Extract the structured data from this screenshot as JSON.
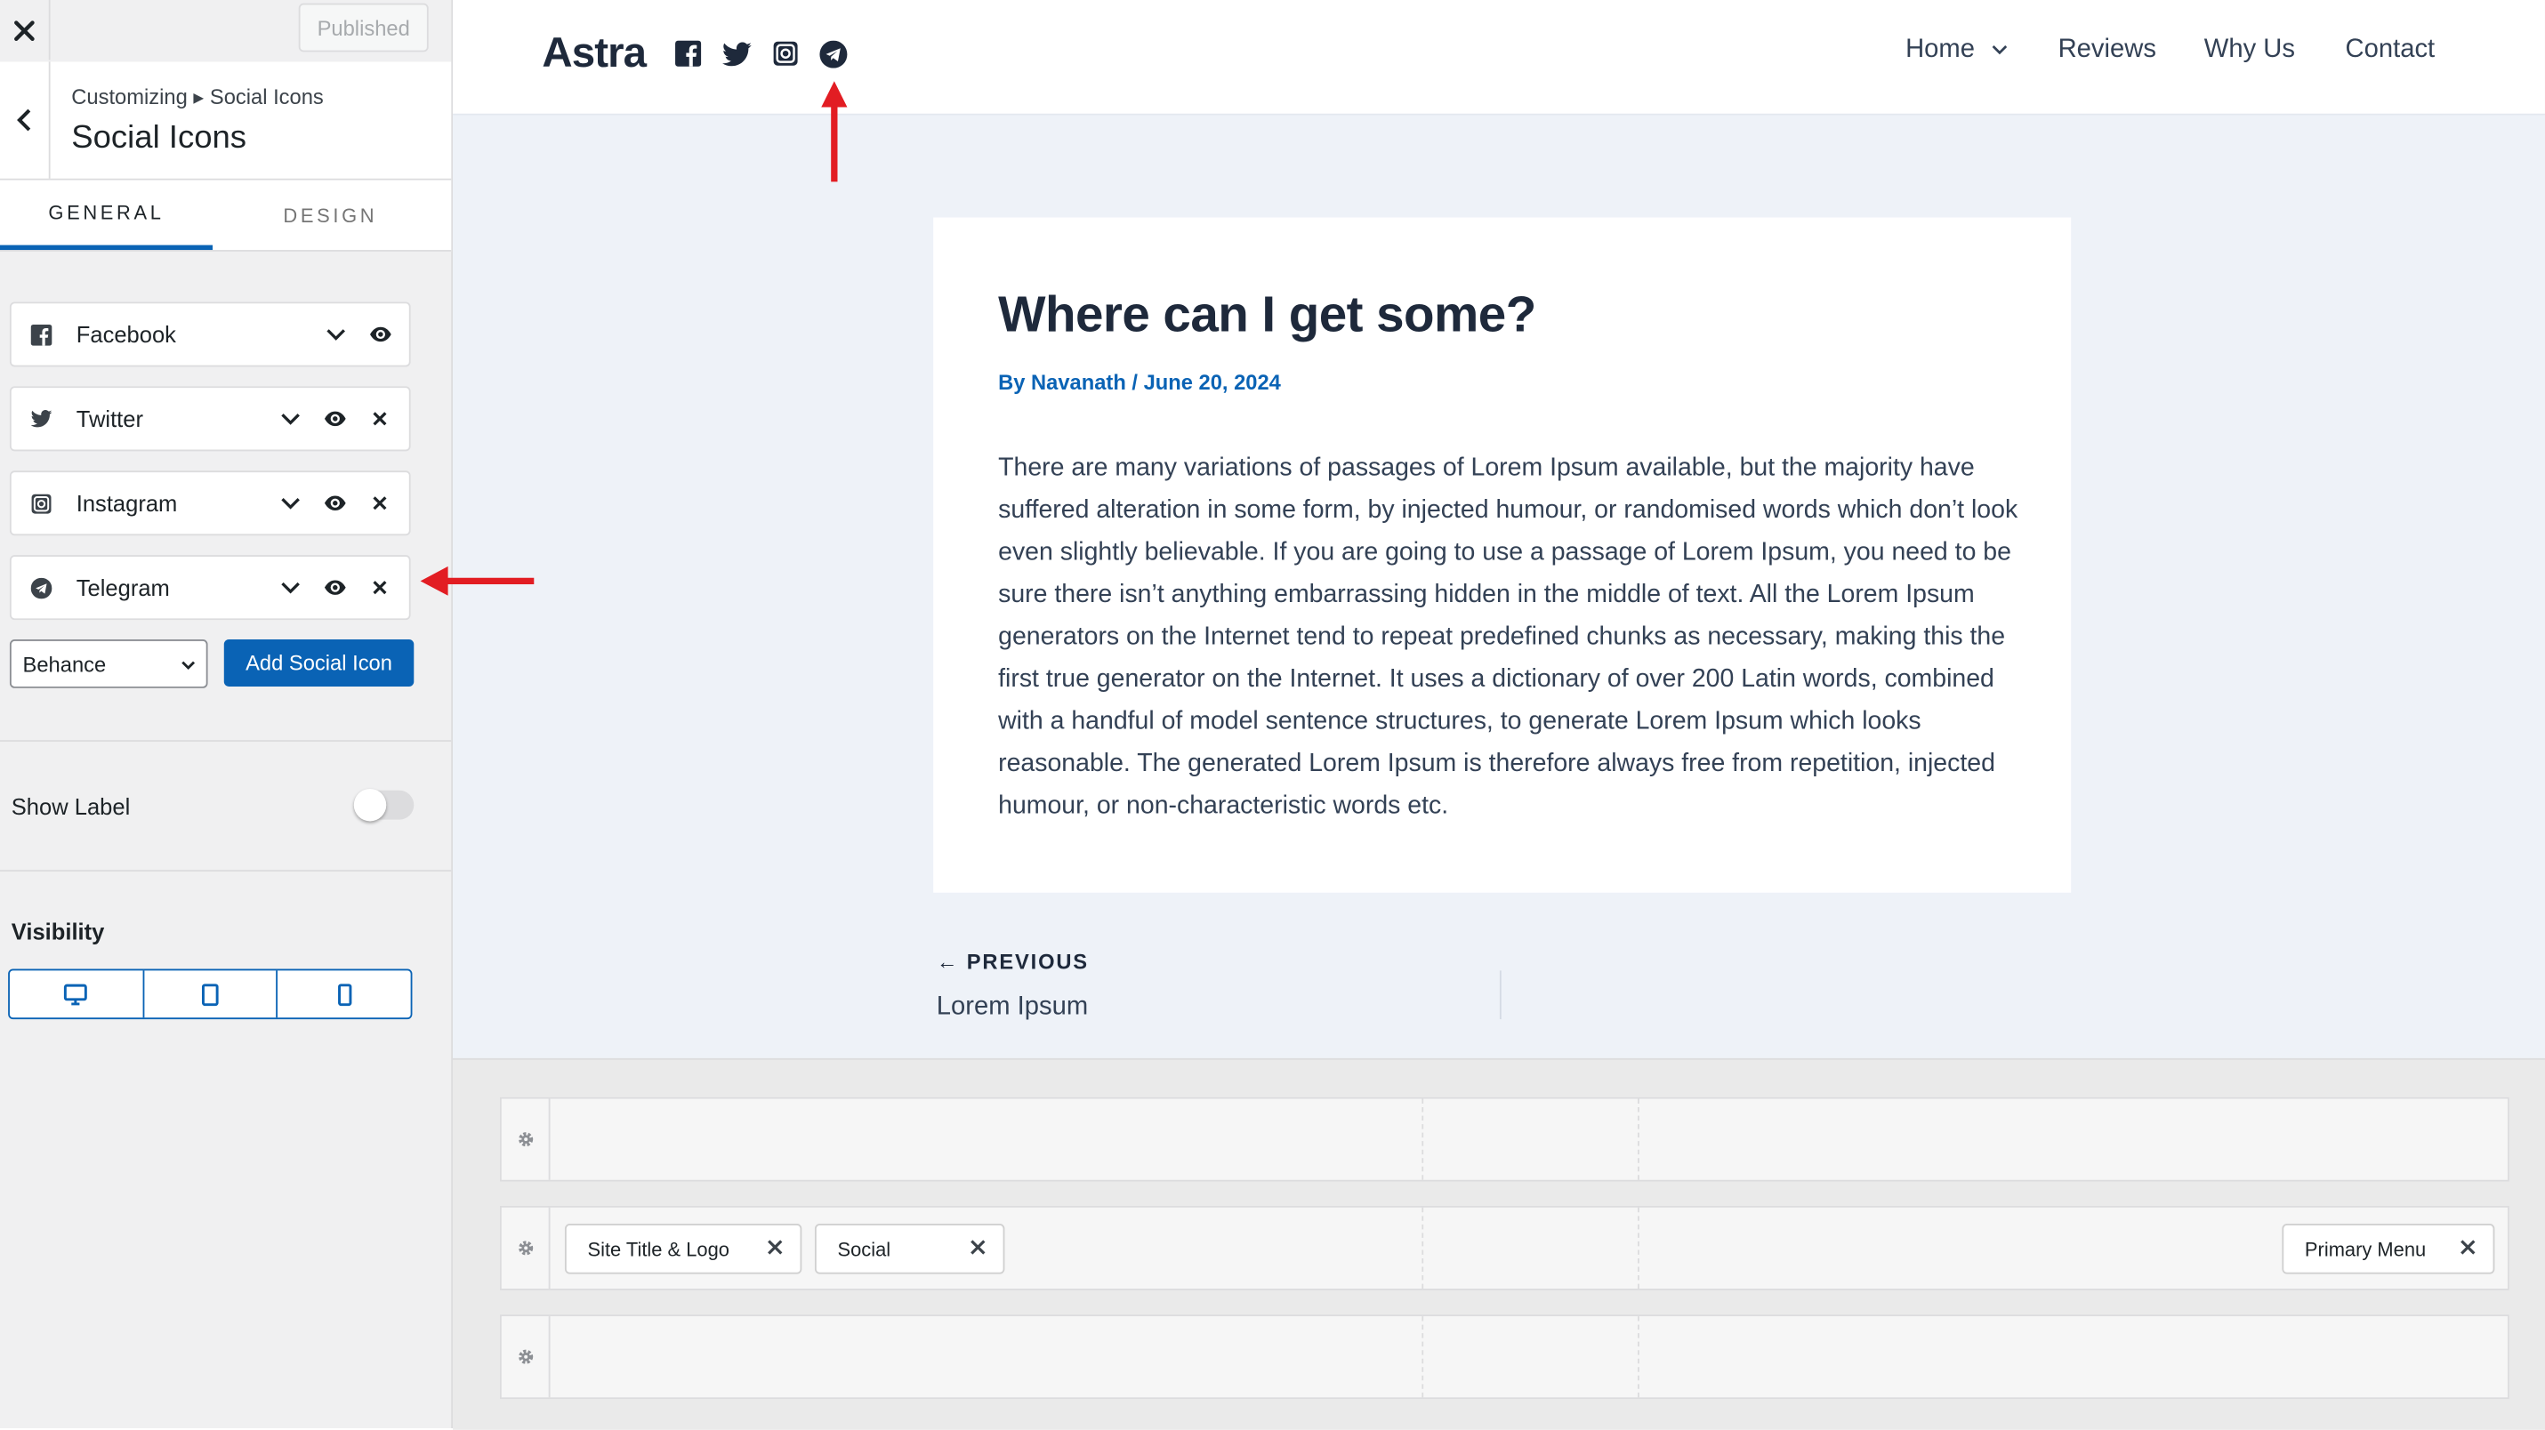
{
  "colors": {
    "accent": "#0a63b5",
    "arrow": "#e21d23",
    "preview_bg": "#eef2f8"
  },
  "topbar": {
    "close_icon": "close-icon",
    "publish_label": "Published"
  },
  "section": {
    "breadcrumb": "Customizing ▸ Social Icons",
    "title": "Social Icons"
  },
  "tabs": [
    {
      "label": "GENERAL",
      "active": true
    },
    {
      "label": "DESIGN",
      "active": false
    }
  ],
  "social_items": [
    {
      "label": "Facebook",
      "icon": "facebook-icon"
    },
    {
      "label": "Twitter",
      "icon": "twitter-icon"
    },
    {
      "label": "Instagram",
      "icon": "instagram-icon"
    },
    {
      "label": "Telegram",
      "icon": "telegram-icon"
    }
  ],
  "add_select": {
    "value": "Behance"
  },
  "add_button": {
    "label": "Add Social Icon"
  },
  "show_label": {
    "label": "Show Label",
    "enabled": false
  },
  "visibility": {
    "title": "Visibility",
    "devices": [
      "desktop-icon",
      "tablet-icon",
      "mobile-icon"
    ]
  },
  "site": {
    "title": "Astra",
    "header_icons": [
      "facebook-icon",
      "twitter-icon",
      "instagram-icon",
      "telegram-icon"
    ],
    "nav": [
      "Home",
      "Reviews",
      "Why Us",
      "Contact"
    ]
  },
  "article": {
    "title": "Where can I get some?",
    "meta": "By Navanath / June 20, 2024",
    "body": "There are many variations of passages of Lorem Ipsum available, but the majority have suffered alteration in some form, by injected humour, or randomised words which don’t look even slightly believable. If you are going to use a passage of Lorem Ipsum, you need to be sure there isn’t anything embarrassing hidden in the middle of text. All the Lorem Ipsum generators on the Internet tend to repeat predefined chunks as necessary, making this the first true generator on the Internet. It uses a dictionary of over 200 Latin words, combined with a handful of model sentence structures, to generate Lorem Ipsum which looks reasonable. The generated Lorem Ipsum is therefore always free from repetition, injected humour, or non-characteristic words etc."
  },
  "post_nav": {
    "prev_label": "PREVIOUS",
    "prev_title": "Lorem Ipsum"
  },
  "builder": {
    "chips_left": [
      {
        "label": "Site Title & Logo"
      },
      {
        "label": "Social"
      }
    ],
    "chips_right": [
      {
        "label": "Primary Menu"
      }
    ]
  }
}
